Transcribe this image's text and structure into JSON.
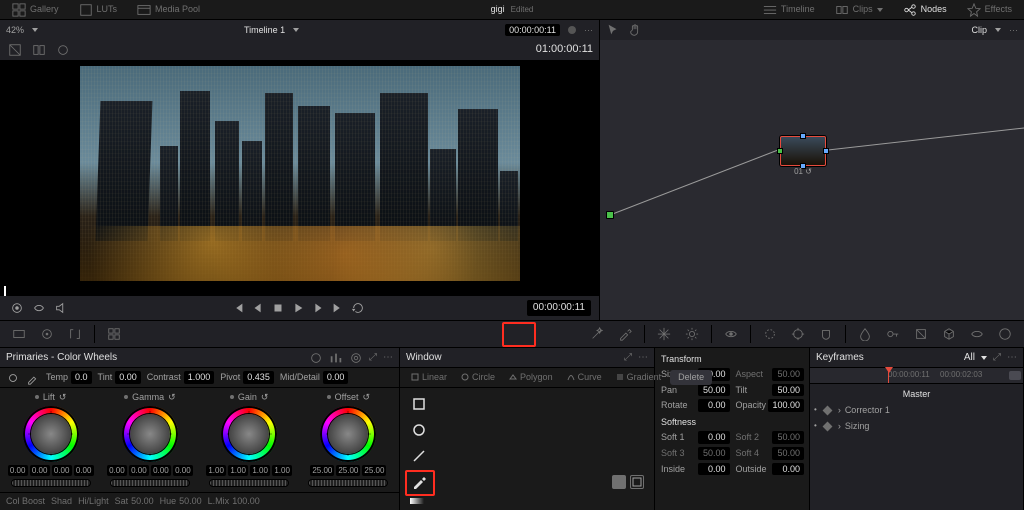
{
  "topbar": {
    "left": [
      {
        "id": "gallery",
        "label": "Gallery",
        "icon": "grid-icon"
      },
      {
        "id": "luts",
        "label": "LUTs",
        "icon": "luts-icon"
      },
      {
        "id": "media-pool",
        "label": "Media Pool",
        "icon": "media-icon"
      }
    ],
    "center_title": "gigi",
    "center_status": "Edited",
    "right": [
      {
        "id": "timeline",
        "label": "Timeline",
        "icon": "timeline-icon"
      },
      {
        "id": "clips",
        "label": "Clips",
        "icon": "clips-icon"
      },
      {
        "id": "nodes",
        "label": "Nodes",
        "icon": "nodes-icon",
        "active": true
      },
      {
        "id": "effects",
        "label": "Effects",
        "icon": "fx-icon"
      }
    ]
  },
  "viewer": {
    "zoom": "42%",
    "title": "Timeline 1",
    "timecode_in": "00:00:00:11",
    "record_tc": "01:00:00:11"
  },
  "transport": {
    "timecode": "00:00:00:11"
  },
  "node_panel": {
    "mode": "Clip",
    "node_label": "01"
  },
  "palette": {
    "items": [
      "camera-raw",
      "color-match",
      "primaries-wheels",
      "primaries-bars",
      "hdr",
      "rgb-mixer",
      "motion-effects",
      "curves",
      "warper",
      "qualifier",
      "window",
      "tracker",
      "magic-mask",
      "blur",
      "key",
      "sizing",
      "3d"
    ]
  },
  "primaries": {
    "title": "Primaries - Color Wheels",
    "top": {
      "temp": "0.0",
      "tint": "0.00",
      "contrast": "1.000",
      "pivot": "0.435",
      "mid_detail": "0.00"
    },
    "wheels": [
      {
        "name": "Lift",
        "vals": [
          "0.00",
          "0.00",
          "0.00",
          "0.00"
        ]
      },
      {
        "name": "Gamma",
        "vals": [
          "0.00",
          "0.00",
          "0.00",
          "0.00"
        ]
      },
      {
        "name": "Gain",
        "vals": [
          "1.00",
          "1.00",
          "1.00",
          "1.00"
        ]
      },
      {
        "name": "Offset",
        "vals": [
          "25.00",
          "25.00",
          "25.00"
        ]
      }
    ],
    "bottom": {
      "col_boost": "",
      "shad": "",
      "hi_light": "",
      "sat": "50.00",
      "hue": "50.00",
      "l_mix": "100.00"
    }
  },
  "window": {
    "title": "Window",
    "tabs": [
      "Linear",
      "Circle",
      "Polygon",
      "Curve",
      "Gradient"
    ],
    "delete": "Delete",
    "shapes": [
      {
        "id": "linear",
        "icon": "square-icon"
      },
      {
        "id": "circle",
        "icon": "circle-icon"
      },
      {
        "id": "poly",
        "icon": "line-icon"
      },
      {
        "id": "curve",
        "icon": "pen-icon"
      },
      {
        "id": "gradient",
        "icon": "gradient-icon"
      }
    ]
  },
  "xform": {
    "transform_title": "Transform",
    "softness_title": "Softness",
    "transform": {
      "size": "50.00",
      "aspect": "50.00",
      "pan": "50.00",
      "tilt": "50.00",
      "rotate": "0.00",
      "opacity": "100.00"
    },
    "softness": {
      "soft1": "0.00",
      "soft2": "50.00",
      "soft3": "50.00",
      "soft4": "50.00",
      "inside": "0.00",
      "outside": "0.00"
    },
    "labels": {
      "size": "Size",
      "aspect": "Aspect",
      "pan": "Pan",
      "tilt": "Tilt",
      "rotate": "Rotate",
      "opacity": "Opacity",
      "soft1": "Soft 1",
      "soft2": "Soft 2",
      "soft3": "Soft 3",
      "soft4": "Soft 4",
      "inside": "Inside",
      "outside": "Outside"
    }
  },
  "keyframes": {
    "title": "Keyframes",
    "mode": "All",
    "tc_start": "00:00:00:11",
    "tc_mid": "00:00:02:03",
    "master": "Master",
    "tracks": [
      "Corrector 1",
      "Sizing"
    ]
  }
}
